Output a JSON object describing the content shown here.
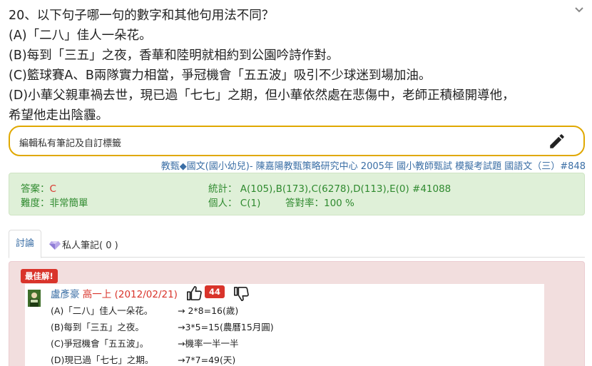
{
  "question": {
    "title": "20、以下句子哪一句的數字和其他句用法不同？",
    "options": [
      "(A)「二八」佳人一朵花。",
      "(B)每到「三五」之夜，香華和陸明就相約到公園吟詩作對。",
      "(C)籃球賽A、B兩隊實力相當，爭冠機會「五五波」吸引不少球迷到場加油。",
      "(D)小華父親車禍去世，現已過「七七」之期，但小華依然處在悲傷中，老師正積極開導他，",
      "希望他走出陰霾。"
    ]
  },
  "note": {
    "label": "編輯私有筆記及自訂標籤"
  },
  "source": {
    "category": "教甄◆國文(國小幼兒)",
    "rest": "- 陳嘉陽教甄策略研究中心 2005年 國小教師甄試 模擬考試題 國語文（三）#848"
  },
  "stats": {
    "answer_label": "答案：",
    "answer_value": "C",
    "difficulty": "難度：非常簡單",
    "stats_line": "統計： A(105),B(173),C(6278),D(113),E(0) #41088",
    "personal": "個人： C(1)",
    "accuracy": "答對率：100 %"
  },
  "tabs": {
    "discussion": "討論",
    "private_notes": "私人筆記( 0 )"
  },
  "best_answer": {
    "badge": "最佳解!",
    "author": "盧彥豪",
    "meta": "高一上 (2012/02/21)",
    "likes": "44",
    "lines": [
      {
        "left": "(A)「二八」佳人一朵花。",
        "right": "→ 2*8=16(歲)"
      },
      {
        "left": "(B)每到「三五」之夜。",
        "right": "→3*5=15(農曆15月圓)"
      },
      {
        "left": "(C)爭冠機會「五五波」。",
        "right": "→機率一半一半"
      },
      {
        "left": "(D)現已過「七七」之期。",
        "right": "→7*7=49(天)"
      }
    ]
  },
  "colors": {
    "link": "#3a6ea5",
    "accent_red": "#d9342b",
    "success_green": "#2f8a2f",
    "note_border": "#e0a800"
  },
  "icons": {
    "collapse": "chevron-down-icon",
    "edit": "pencil-icon",
    "gem": "gem-icon",
    "like": "thumbs-up-icon",
    "dislike": "thumbs-down-icon"
  }
}
